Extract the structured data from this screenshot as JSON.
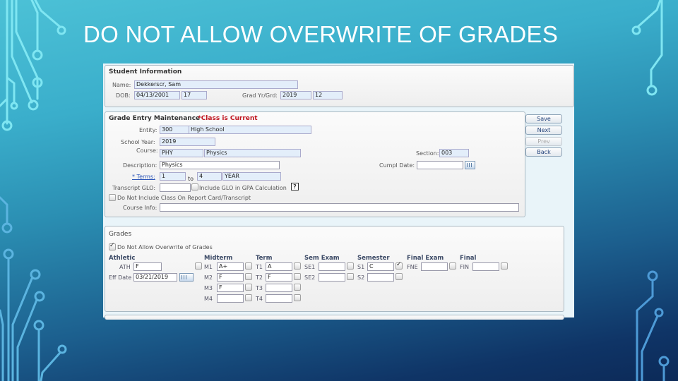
{
  "slide": {
    "title": "DO NOT ALLOW OVERWRITE OF GRADES",
    "colors": {
      "title": "#ffffff",
      "circuit": "#7fe6f2",
      "bg_top": "#4cc1d6",
      "bg_bottom": "#0c2a58"
    }
  },
  "student_info": {
    "header": "Student Information",
    "name_label": "Name:",
    "name": "Dekkerscr, Sam",
    "dob_label": "DOB:",
    "dob": "04/13/2001",
    "age": "17",
    "grad_label": "Grad Yr/Grd:",
    "grad_year": "2019",
    "grade": "12"
  },
  "grade_entry": {
    "header": "Grade Entry Maintenance",
    "status": "*Class is Current",
    "entity_label": "Entity:",
    "entity_code": "300",
    "entity_name": "High School",
    "school_year_label": "School Year:",
    "school_year": "2019",
    "course_label": "Course:",
    "course_code": "PHY",
    "course_name": "Physics",
    "section_label": "Section:",
    "section": "003",
    "description_label": "Description:",
    "description": "Physics",
    "cumpl_date_label": "Cumpl Date:",
    "cumpl_date": "",
    "terms_label": "* Terms:",
    "terms_from": "1",
    "terms_to_label": "to",
    "terms_to": "4",
    "terms_type": "YEAR",
    "transcript_glo_label": "Transcript GLO:",
    "transcript_glo": "",
    "include_glo_label": "Include GLO in GPA Calculation",
    "include_glo_checked": false,
    "help_label": "?",
    "do_not_include_label": "Do Not Include Class On Report Card/Transcript",
    "do_not_include_checked": false,
    "course_info_label": "Course Info:",
    "course_info": ""
  },
  "buttons": {
    "save": "Save",
    "next": "Next",
    "prev": "Prev",
    "back": "Back"
  },
  "grades": {
    "header": "Grades",
    "no_overwrite_label": "Do Not Allow Overwrite of Grades",
    "no_overwrite_checked": true,
    "athletic": {
      "header": "Athletic",
      "ath_label": "ATH",
      "ath_value": "F",
      "elig_date_label": "Eff Date",
      "elig_date": "03/21/2019"
    },
    "midterm": {
      "header": "Midterm",
      "rows": [
        {
          "label": "M1",
          "value": "A+",
          "checked": false
        },
        {
          "label": "M2",
          "value": "F",
          "checked": false
        },
        {
          "label": "M3",
          "value": "F",
          "checked": false
        },
        {
          "label": "M4",
          "value": "",
          "checked": false
        }
      ]
    },
    "term": {
      "header": "Term",
      "rows": [
        {
          "label": "T1",
          "value": "A",
          "checked": false
        },
        {
          "label": "T2",
          "value": "F",
          "checked": false
        },
        {
          "label": "T3",
          "value": "",
          "checked": false
        },
        {
          "label": "T4",
          "value": "",
          "checked": false
        }
      ]
    },
    "sem_exam": {
      "header": "Sem Exam",
      "rows": [
        {
          "label": "SE1",
          "value": "",
          "checked": false
        },
        {
          "label": "SE2",
          "value": "",
          "checked": false
        }
      ]
    },
    "semester": {
      "header": "Semester",
      "rows": [
        {
          "label": "S1",
          "value": "C",
          "checked": true
        },
        {
          "label": "S2",
          "value": "",
          "checked": false
        }
      ]
    },
    "final_exam": {
      "header": "Final Exam",
      "rows": [
        {
          "label": "FNE",
          "value": "",
          "checked": false
        }
      ]
    },
    "final": {
      "header": "Final",
      "rows": [
        {
          "label": "FIN",
          "value": "",
          "checked": false
        }
      ]
    }
  }
}
